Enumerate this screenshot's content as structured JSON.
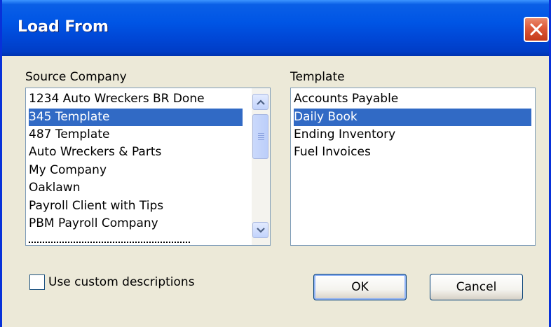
{
  "window": {
    "title": "Load From"
  },
  "source": {
    "label": "Source Company",
    "items": [
      "1234 Auto Wreckers BR Done",
      "345 Template",
      "487 Template",
      "Auto Wreckers & Parts",
      "My Company",
      "Oaklawn",
      "Payroll Client with Tips",
      "PBM Payroll Company"
    ],
    "selected_index": 1
  },
  "template": {
    "label": "Template",
    "items": [
      "Accounts Payable",
      "Daily Book",
      "Ending Inventory",
      "Fuel Invoices"
    ],
    "selected_index": 1
  },
  "options": {
    "custom_descriptions_label": "Use custom descriptions",
    "custom_descriptions_checked": false
  },
  "buttons": {
    "ok": "OK",
    "cancel": "Cancel"
  }
}
